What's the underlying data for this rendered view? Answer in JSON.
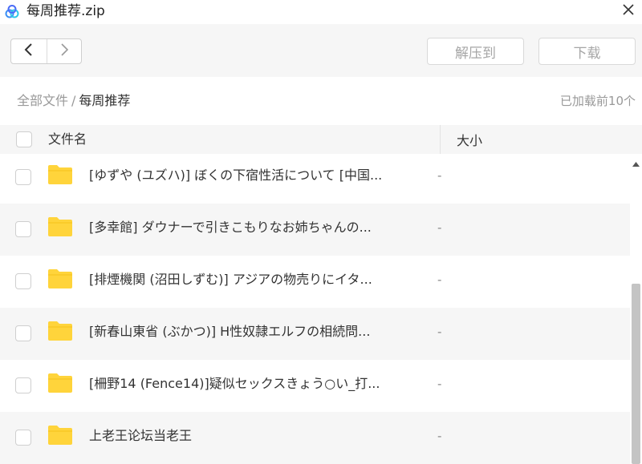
{
  "window": {
    "title": "每周推荐.zip",
    "app_icon": "baidu-netdisk-icon",
    "close_icon": "close-icon"
  },
  "toolbar": {
    "back_icon": "chevron-left-icon",
    "forward_icon": "chevron-right-icon",
    "extract_label": "解压到",
    "download_label": "下载"
  },
  "breadcrumb": {
    "root": "全部文件",
    "separator": "/",
    "current": "每周推荐"
  },
  "status": "已加载前10个",
  "table": {
    "col_name": "文件名",
    "col_size": "大小",
    "rows": [
      {
        "name": "[ゆずや (ユズハ)] ぼくの下宿性活について [中国...",
        "size": "-",
        "icon": "folder-icon"
      },
      {
        "name": "[多幸館] ダウナーで引きこもりなお姉ちゃんの...",
        "size": "-",
        "icon": "folder-icon"
      },
      {
        "name": "[排煙機関 (沼田しずむ)] アジアの物売りにイタ...",
        "size": "-",
        "icon": "folder-icon"
      },
      {
        "name": "[新春山東省 (ぶかつ)] H性奴隷エルフの相続問...",
        "size": "-",
        "icon": "folder-icon"
      },
      {
        "name": "[柵野14 (Fence14)]疑似セックスきょう○い_打...",
        "size": "-",
        "icon": "folder-icon"
      },
      {
        "name": "上老王论坛当老王",
        "size": "-",
        "icon": "folder-icon"
      }
    ]
  },
  "colors": {
    "folder": "#FFD43B",
    "toolbar_bg": "#F6F6F6",
    "scroll_thumb": "#C4C4C4"
  }
}
